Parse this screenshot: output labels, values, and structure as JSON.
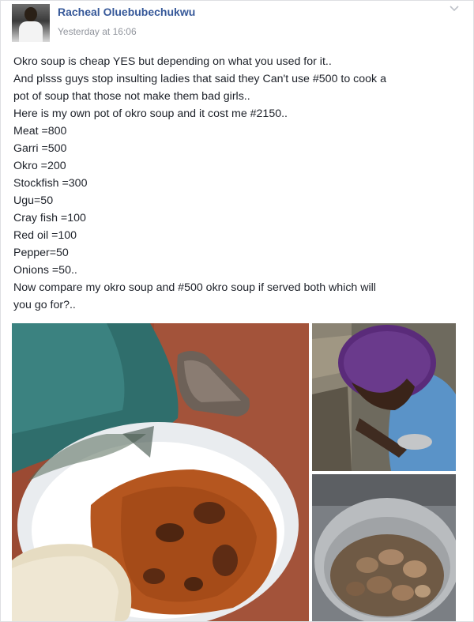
{
  "post": {
    "author": "Racheal Oluebubechukwu",
    "timestamp": "Yesterday at 16:06",
    "lines": [
      "Okro soup is cheap YES but depending on what you used for it..",
      "And plsss guys stop insulting ladies that said they Can't use #500 to cook a",
      "pot of soup that those not make them bad girls..",
      "Here is my own pot of okro soup and it cost me #2150..",
      "Meat =800",
      "Garri =500",
      "Okro =200",
      "Stockfish =300",
      "Ugu=50",
      "Cray fish =100",
      "Red oil =100",
      "Pepper=50",
      "Onions =50..",
      "Now compare my okro soup and #500 okro soup if served both which will",
      "you go for?.."
    ]
  },
  "icons": {
    "menu": "chevron-down-icon"
  },
  "colors": {
    "author_link": "#365899",
    "timestamp": "#90949c",
    "text": "#1d2129",
    "card_border": "#dddfe2"
  }
}
